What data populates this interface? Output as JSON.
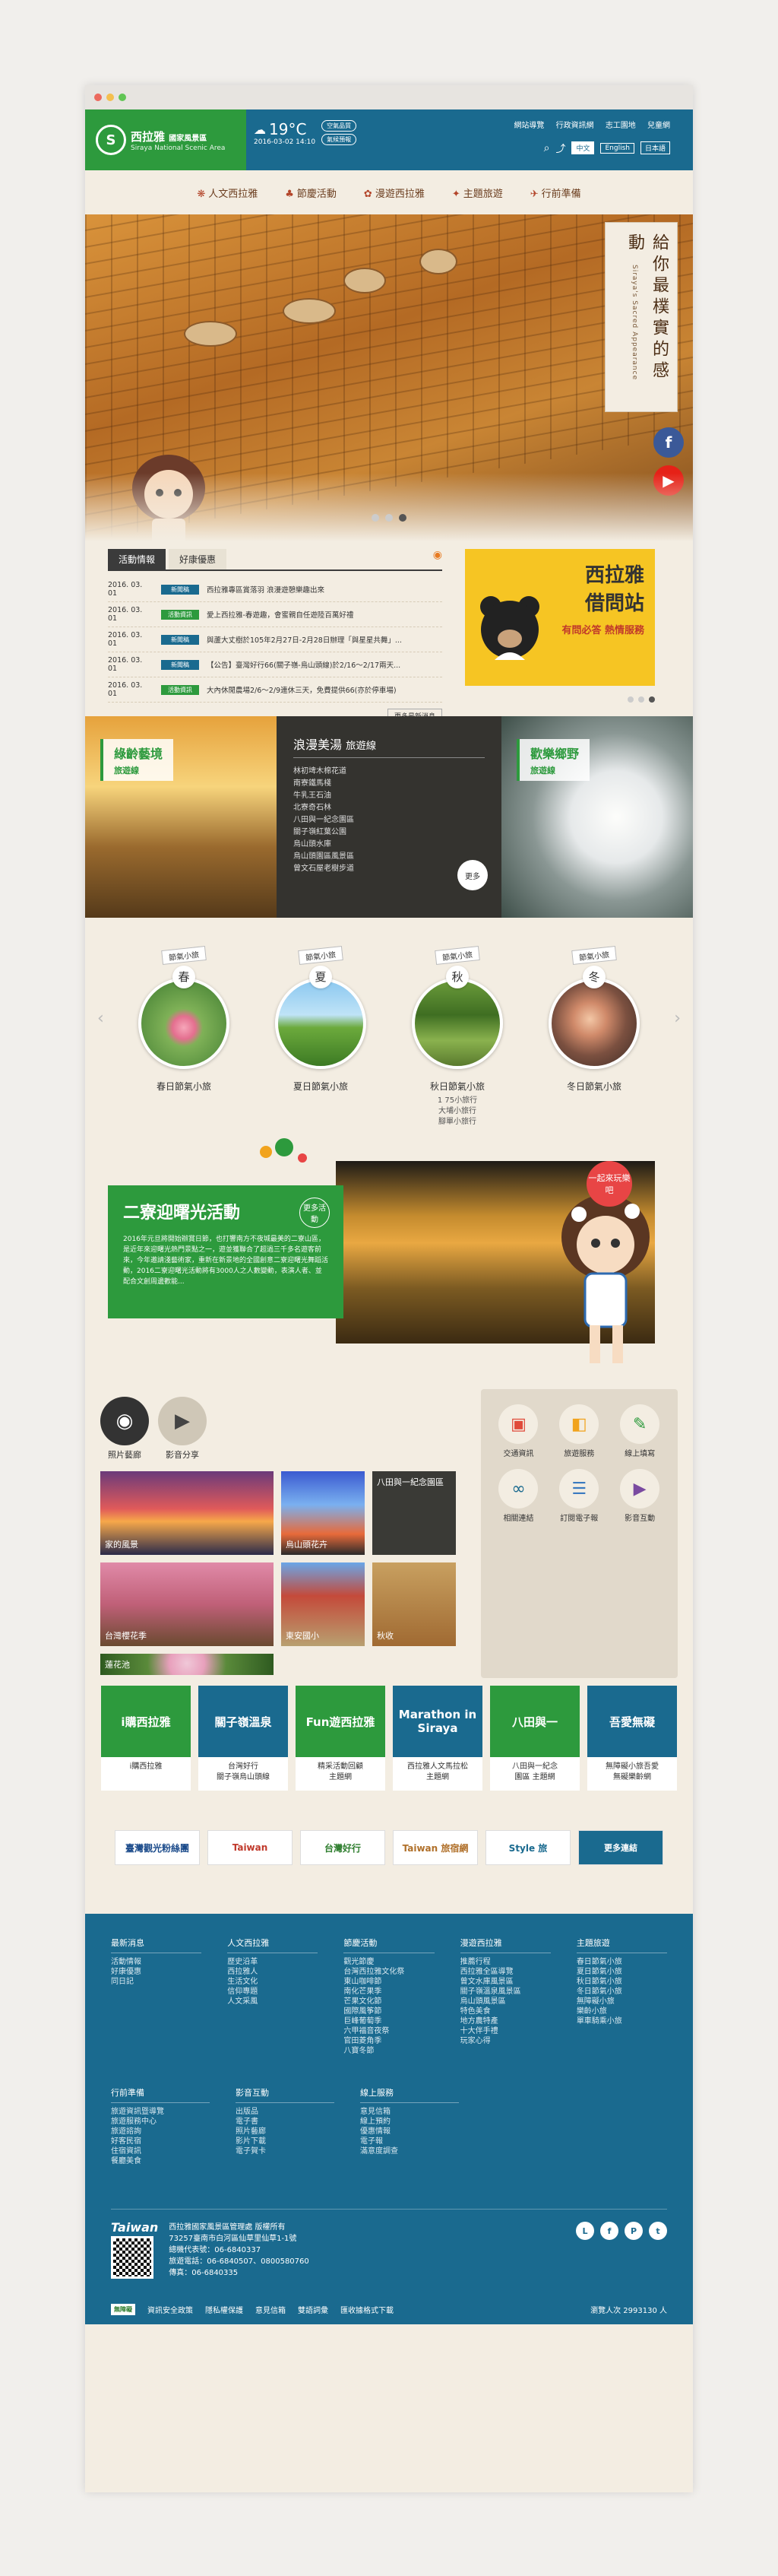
{
  "header": {
    "logo_title": "西拉雅",
    "logo_sub": "國家風景區",
    "logo_en": "Siraya National Scenic Area",
    "temp": "19°C",
    "date": "2016-03-02 14:10",
    "weather_btn1": "空氣品質",
    "weather_btn2": "氣候預報",
    "top_links": [
      "網站導覽",
      "行政資訊網",
      "志工園地",
      "兒童網"
    ],
    "langs": [
      "中文",
      "English",
      "日本語"
    ]
  },
  "nav": [
    "人文西拉雅",
    "節慶活動",
    "漫遊西拉雅",
    "主題旅遊",
    "行前準備"
  ],
  "hero": {
    "banner": "給你最樸實的感動",
    "banner_en": "Siraya's Sacred Appearance",
    "fb_label": "西拉雅 粉絲團",
    "yt_label": "西拉雅 影音頻道"
  },
  "news": {
    "tab_active": "活動情報",
    "tab_other": "好康優惠",
    "more": "更多最新消息",
    "items": [
      {
        "date": "2016. 03. 01",
        "badge": "新聞稿",
        "color": "#1a6a8f",
        "text": "西拉雅專區賞落羽 浪漫遊憩樂趣出來"
      },
      {
        "date": "2016. 03. 01",
        "badge": "活動資訊",
        "color": "#2d9a3d",
        "text": "愛上西拉雅-春遊趣，會蜜親自任遊陸百萬好禮"
      },
      {
        "date": "2016. 03. 01",
        "badge": "新聞稿",
        "color": "#1a6a8f",
        "text": "與蘆大丈樹於105年2月27日-2月28日辦理「與星星共舞」..."
      },
      {
        "date": "2016. 03. 01",
        "badge": "新聞稿",
        "color": "#1a6a8f",
        "text": "【公告】臺灣好行66(關子嶺-烏山頭線)於2/16～2/17兩天..."
      },
      {
        "date": "2016. 03. 01",
        "badge": "活動資訊",
        "color": "#2d9a3d",
        "text": "大內休閒農場2/6～2/9連休三天，免費提供66(亦於停車場)"
      }
    ]
  },
  "ad": {
    "line1": "西拉雅",
    "line2": "借問站",
    "line3": "有問必答 熱情服務"
  },
  "routes": {
    "left": {
      "title": "綠齡藝境",
      "sub": "旅遊線"
    },
    "mid": {
      "title": "浪漫美湯",
      "sub": "旅遊線",
      "items": [
        "林初埤木棉花道",
        "南寮鐵馬棧",
        "牛乳王石油",
        "北寮奇石林",
        "八田與一紀念園區",
        "關子嶺紅葉公園",
        "烏山頭水庫",
        "烏山頭園區風景區",
        "曾文石屋老樹步道"
      ],
      "more": "更多"
    },
    "right": {
      "title": "歡樂鄉野",
      "sub": "旅遊線"
    }
  },
  "seasons": [
    {
      "tag": "節氣小旅",
      "char": "春",
      "name": "春日節氣小旅",
      "sub": []
    },
    {
      "tag": "節氣小旅",
      "char": "夏",
      "name": "夏日節氣小旅",
      "sub": []
    },
    {
      "tag": "節氣小旅",
      "char": "秋",
      "name": "秋日節氣小旅",
      "sub": [
        "1 75小旅行",
        "大埔小旅行",
        "腳單小旅行"
      ]
    },
    {
      "tag": "節氣小旅",
      "char": "冬",
      "name": "冬日節氣小旅",
      "sub": []
    }
  ],
  "event": {
    "title": "二寮迎曙光活動",
    "more": "更多活動",
    "desc": "2016年元旦將開始辦賞日節，也打響南方不夜城最美的二寮山區，是近年來迎曙光熱門景點之一，遊並獲聯合了超過三千多名遊客前來，今年邀請淺藝術家，重新在新景地的全國創意二寮迎曙光舞蹈活動，2016二寮迎曙光活動將有3000人之人數變動，表演人者、並配合文創周邊歡能...",
    "bubble": "一起來玩樂吧"
  },
  "photos": {
    "tabs": [
      "照片藝廊",
      "影音分享"
    ],
    "items": [
      "家的風景",
      "烏山頭花卉",
      "八田與一紀念園區",
      "台灣櫻花季",
      "東安國小",
      "秋收",
      "蓮花池"
    ]
  },
  "services": [
    "交通資訊",
    "旅遊服務",
    "線上填寫",
    "相關連結",
    "訂閱電子報",
    "影音互動"
  ],
  "promos": [
    {
      "name": "i購西拉雅",
      "caption": "i購西拉雅",
      "color": "#2d9a3d"
    },
    {
      "name": "關子嶺溫泉",
      "caption": "台灣好行\n關子嶺烏山頭線",
      "color": "#1a6a8f"
    },
    {
      "name": "Fun遊西拉雅",
      "caption": "精采活動回顧\n主題網",
      "color": "#2d9a3d"
    },
    {
      "name": "Marathon in Siraya",
      "caption": "西拉雅人文馬拉松\n主題網",
      "color": "#1a6a8f"
    },
    {
      "name": "八田與一",
      "caption": "八田與一紀念\n園區 主題網",
      "color": "#2d9a3d"
    },
    {
      "name": "吾愛無礙",
      "caption": "無障礙小旅吾愛\n無礙樂齡網",
      "color": "#1a6a8f"
    }
  ],
  "partners": [
    "臺灣觀光粉絲團",
    "Taiwan",
    "台灣好行",
    "Taiwan 旅宿網",
    "Style 旅",
    "更多連結"
  ],
  "footer": {
    "cols": [
      {
        "title": "最新消息",
        "items": [
          "活動情報",
          "好康優惠",
          "同日記"
        ]
      },
      {
        "title": "人文西拉雅",
        "items": [
          "歷史沿革",
          "西拉雅人",
          "生活文化",
          "信仰專題",
          "人文采風"
        ]
      },
      {
        "title": "節慶活動",
        "items": [
          "觀光節慶",
          "台灣西拉雅文化祭",
          "東山咖啡節",
          "南化芒果季",
          "芒果文化節",
          "國際風筝節",
          "巨峰葡萄季",
          "六甲福音夜祭",
          "官田菱角季",
          "八寶冬節"
        ]
      },
      {
        "title": "漫遊西拉雅",
        "items": [
          "推薦行程",
          "西拉雅全區導覽",
          "曾文水庫風景區",
          "關子嶺溫泉風景區",
          "烏山頭風景區",
          "特色美食",
          "地方農特產",
          "十大伴手禮",
          "玩家心得"
        ]
      },
      {
        "title": "主題旅遊",
        "items": [
          "春日節氣小旅",
          "夏日節氣小旅",
          "秋日節氣小旅",
          "冬日節氣小旅",
          "無障礙小旅",
          "樂齡小旅",
          "單車騎乘小旅"
        ]
      }
    ],
    "cols2": [
      {
        "title": "行前準備",
        "items": [
          "旅遊資訊暨導覽",
          "旅遊服務中心",
          "旅遊諮詢",
          "好客民宿",
          "住宿資訊",
          "餐廳美食"
        ]
      },
      {
        "title": "影音互動",
        "items": [
          "出版品",
          "電子書",
          "照片藝廊",
          "影片下載",
          "電子賀卡"
        ]
      },
      {
        "title": "線上服務",
        "items": [
          "意見信箱",
          "線上預約",
          "優惠情報",
          "電子報",
          "滿意度調查"
        ]
      }
    ],
    "brand": "Taiwan",
    "org": "西拉雅國家風景區管理處 版權所有",
    "addr": "73257臺南市白河區仙草里仙草1-1號",
    "tel": "總機代表號：06-6840337",
    "svc": "旅遊電話：06-6840507、0800580760",
    "fax": "傳真：06-6840335",
    "links": [
      "資訊安全政策",
      "隱私權保護",
      "意見信箱",
      "雙語詞彙",
      "匯收據格式下載"
    ],
    "count": "瀏覽人次 2993130 人",
    "acc": "無障礙"
  }
}
